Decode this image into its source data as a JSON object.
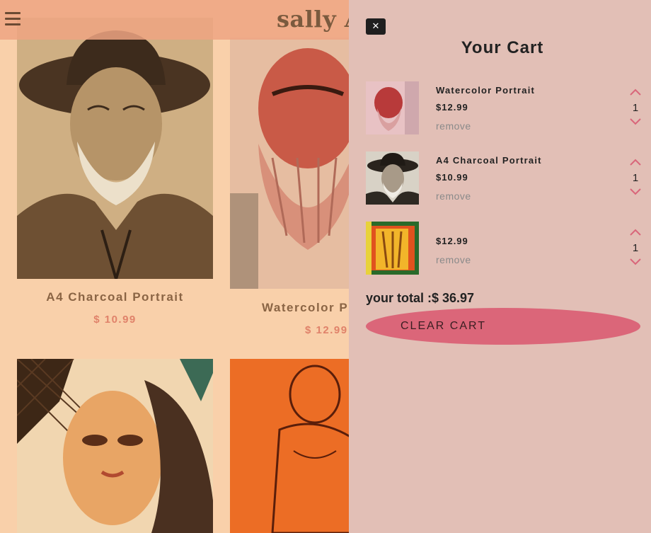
{
  "navbar": {
    "brand": "sally A",
    "menu_icon": "hamburger-icon"
  },
  "products": [
    {
      "title": "A4 Charcoal Portrait",
      "price": "$ 10.99"
    },
    {
      "title": "Watercolor P",
      "price": "$ 12.99"
    }
  ],
  "cart": {
    "close_label": "✕",
    "title": "Your Cart",
    "items": [
      {
        "name": "Watercolor Portrait",
        "price": "$12.99",
        "remove": "remove",
        "qty": "1"
      },
      {
        "name": "A4 Charcoal Portrait",
        "price": "$10.99",
        "remove": "remove",
        "qty": "1"
      },
      {
        "name": "",
        "price": "$12.99",
        "remove": "remove",
        "qty": "1"
      }
    ],
    "total_label": "your total :",
    "total_value": "$ 36.97",
    "clear_label": "CLEAR CART",
    "icons": {
      "increase": "chevron-up-icon",
      "decrease": "chevron-down-icon",
      "close": "close-icon"
    }
  },
  "colors": {
    "page_bg": "#f9d0aa",
    "navbar_bg": "#eea582",
    "cart_bg": "#e2bfb6",
    "accent": "#db6679",
    "price": "#e0826a",
    "chevron": "#d9667a"
  }
}
